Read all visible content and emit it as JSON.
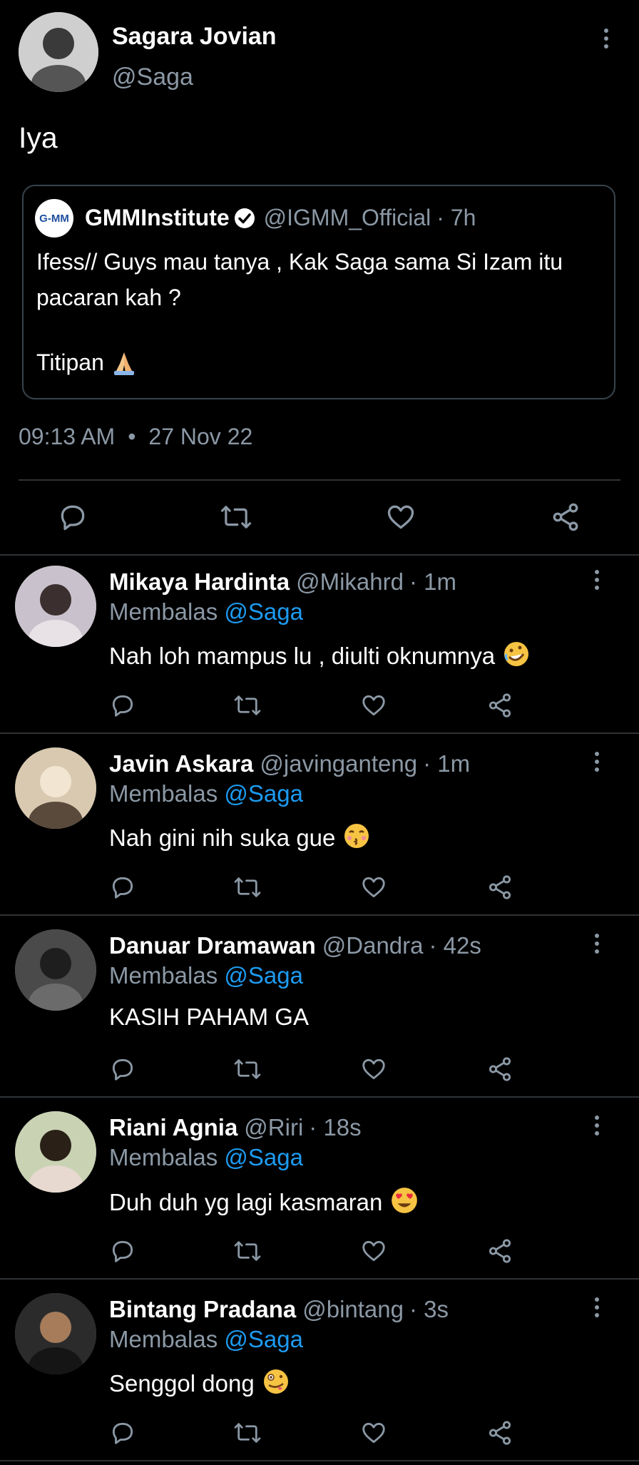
{
  "main_tweet": {
    "display_name": "Sagara Jovian",
    "handle": "@Saga",
    "text": "Iya",
    "timestamp": "09:13 AM",
    "date": "27 Nov 22",
    "quoted": {
      "logo_text": "G-MM",
      "display_name": "GMMInstitute",
      "handle": "@IGMM_Official",
      "time": "· 7h",
      "line1": "Ifess// Guys mau tanya , Kak Saga sama Si Izam itu",
      "line2": "pacaran kah ?",
      "line3": "Titipan"
    }
  },
  "reply_prefix": "Membalas",
  "reply_to": "@Saga",
  "replies": [
    {
      "name": "Mikaya Hardinta",
      "handle": "@Mikahrd",
      "time": "· 1m",
      "text": "Nah loh mampus lu , diulti oknumnya",
      "emoji": "rofl"
    },
    {
      "name": "Javin Askara",
      "handle": "@javinganteng",
      "time": "· 1m",
      "text": "Nah gini nih suka gue",
      "emoji": "kiss"
    },
    {
      "name": "Danuar Dramawan",
      "handle": "@Dandra",
      "time": "· 42s",
      "text": "KASIH PAHAM GA",
      "emoji": ""
    },
    {
      "name": "Riani Agnia",
      "handle": "@Riri",
      "time": "· 18s",
      "text": "Duh duh yg lagi kasmaran",
      "emoji": "heart-eyes"
    },
    {
      "name": "Bintang Pradana",
      "handle": "@bintang",
      "time": "· 3s",
      "text": "Senggol dong",
      "emoji": "zany"
    }
  ],
  "colors": {
    "background": "#000000",
    "text": "#ffffff",
    "secondary": "#8b98a5",
    "accent": "#1d9bf0",
    "divider": "#2f3336"
  }
}
